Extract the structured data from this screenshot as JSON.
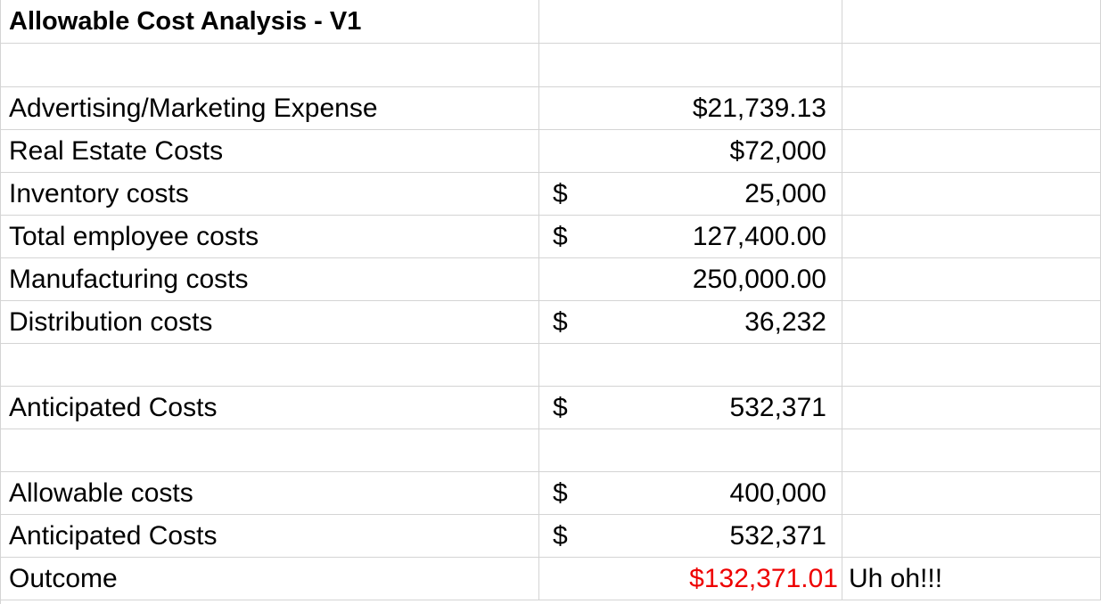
{
  "sheet": {
    "title": "Allowable Cost Analysis - V1",
    "items": [
      {
        "label": "Advertising/Marketing Expense",
        "symbol": "",
        "amount": "$21,739.13"
      },
      {
        "label": "Real Estate Costs",
        "symbol": "",
        "amount": "$72,000"
      },
      {
        "label": "Inventory costs",
        "symbol": "$",
        "amount": "25,000"
      },
      {
        "label": "Total employee costs",
        "symbol": "$",
        "amount": "127,400.00"
      },
      {
        "label": "Manufacturing costs",
        "symbol": "",
        "amount": "250,000.00"
      },
      {
        "label": "Distribution costs",
        "symbol": "$",
        "amount": "36,232"
      }
    ],
    "anticipated": {
      "label": "Anticipated Costs",
      "symbol": "$",
      "amount": "532,371"
    },
    "comparison": [
      {
        "label": "Allowable costs",
        "symbol": "$",
        "amount": "400,000"
      },
      {
        "label": "Anticipated Costs",
        "symbol": "$",
        "amount": "532,371"
      }
    ],
    "outcome": {
      "label": "Outcome",
      "amount": "$132,371.01",
      "note": "Uh oh!!!"
    },
    "colors": {
      "negative": "#ee0000",
      "gridline": "#d4d4d4"
    }
  }
}
